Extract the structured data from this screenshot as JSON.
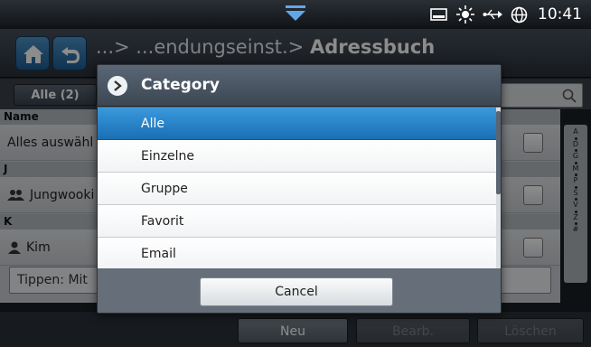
{
  "status_bar": {
    "time": "10:41",
    "icons": [
      "battery-icon",
      "brightness-icon",
      "usb-icon",
      "globe-icon"
    ]
  },
  "title_bar": {
    "breadcrumb_prefix": "...> ...endungseinst.>",
    "current": "Adressbuch"
  },
  "filter": {
    "button_label": "Alle (2)"
  },
  "list": {
    "column_header": "Name",
    "select_all": "Alles auswähl",
    "groups": [
      {
        "letter": "J",
        "entries": [
          {
            "name": "Jungwooki",
            "icon": "group-icon"
          }
        ]
      },
      {
        "letter": "K",
        "entries": [
          {
            "name": "Kim",
            "icon": "person-icon"
          }
        ]
      }
    ],
    "hint_field": "Tippen: Mit"
  },
  "alphabet_index": [
    "A",
    "D",
    "G",
    "M",
    "P",
    "S",
    "V",
    "Z",
    "#"
  ],
  "toolbar": {
    "new_label": "Neu",
    "edit_label": "Bearb.",
    "delete_label": "Löschen"
  },
  "dialog": {
    "title": "Category",
    "options": [
      "Alle",
      "Einzelne",
      "Gruppe",
      "Favorit",
      "Email"
    ],
    "selected_index": 0,
    "cancel_label": "Cancel"
  },
  "colors": {
    "accent": "#1a6fb4",
    "title_bar": "#2a3038"
  }
}
